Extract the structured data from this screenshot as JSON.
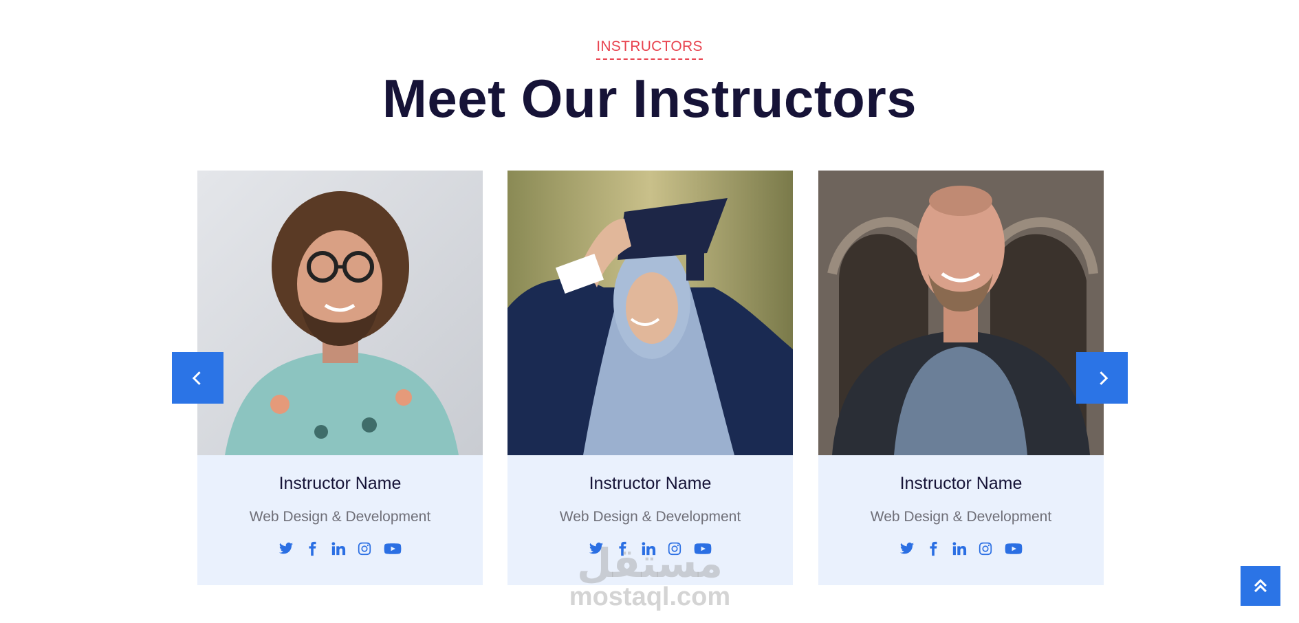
{
  "section": {
    "eyebrow": "INSTRUCTORS",
    "title": "Meet Our Instructors"
  },
  "instructors": [
    {
      "name": "Instructor Name",
      "role": "Web Design & Development",
      "photo": "curly-haired man with glasses in floral shirt"
    },
    {
      "name": "Instructor Name",
      "role": "Web Design & Development",
      "photo": "woman in hijab with graduation cap"
    },
    {
      "name": "Instructor Name",
      "role": "Web Design & Development",
      "photo": "smiling man with backpack in front of arches"
    }
  ],
  "socials": [
    "twitter-icon",
    "facebook-icon",
    "linkedin-icon",
    "instagram-icon",
    "youtube-icon"
  ],
  "carousel": {
    "prev_icon": "chevron-left-icon",
    "next_icon": "chevron-right-icon"
  },
  "scroll_top_icon": "double-chevron-up-icon",
  "watermark": {
    "arabic": "مستقل",
    "latin": "mostaql.com"
  },
  "colors": {
    "accent": "#2b74e6",
    "eyebrow": "#e8434f",
    "title": "#161337",
    "card_bg": "#eaf1fd"
  }
}
